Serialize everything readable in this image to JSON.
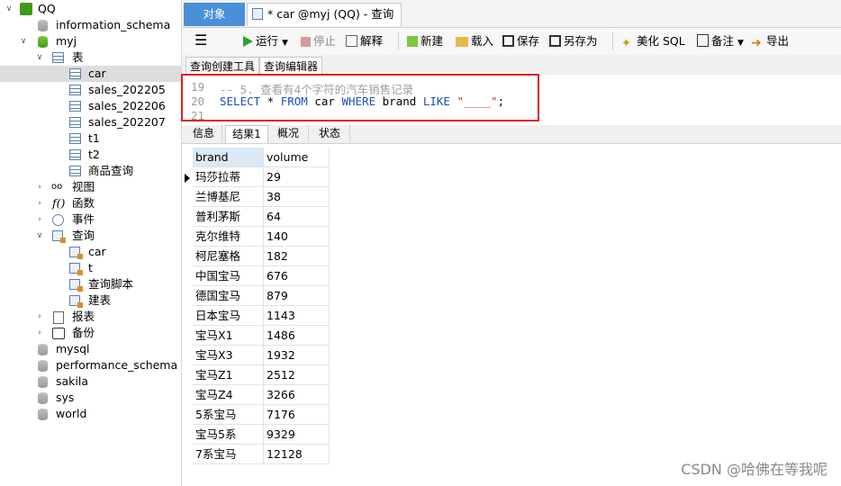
{
  "sidebar": {
    "connection": "QQ",
    "databases_top": [
      "information_schema"
    ],
    "active_db": "myj",
    "tables_label": "表",
    "tables": [
      "car",
      "sales_202205",
      "sales_202206",
      "sales_202207",
      "t1",
      "t2",
      "商品查询"
    ],
    "selected_table": "car",
    "views_label": "视图",
    "functions_label": "函数",
    "events_label": "事件",
    "queries_label": "查询",
    "queries": [
      "car",
      "t",
      "查询脚本",
      "建表"
    ],
    "reports_label": "报表",
    "backup_label": "备份",
    "databases_bottom": [
      "mysql",
      "performance_schema",
      "sakila",
      "sys",
      "world"
    ]
  },
  "tabs": {
    "objects": "对象",
    "query_tab": "* car @myj (QQ) - 查询"
  },
  "toolbar": {
    "run": "运行",
    "stop": "停止",
    "explain": "解释",
    "new": "新建",
    "load": "载入",
    "save": "保存",
    "save_as": "另存为",
    "beautify": "美化 SQL",
    "note": "备注",
    "export": "导出"
  },
  "subtabs": {
    "builder": "查询创建工具",
    "editor": "查询编辑器"
  },
  "editor": {
    "lines": [
      {
        "num": "19",
        "comment": "-- 5. 查看有4个字符的汽车销售记录"
      },
      {
        "num": "20",
        "sql_kw1": "SELECT",
        "sql_a": " * ",
        "sql_kw2": "FROM",
        "sql_b": " car ",
        "sql_kw3": "WHERE",
        "sql_c": " brand ",
        "sql_kw4": "LIKE",
        "sql_str": " \"____\"",
        "sql_end": ";"
      },
      {
        "num": "21"
      }
    ]
  },
  "result_tabs": [
    "信息",
    "结果1",
    "概况",
    "状态"
  ],
  "grid": {
    "columns": [
      "brand",
      "volume"
    ],
    "rows": [
      [
        "玛莎拉蒂",
        "29"
      ],
      [
        "兰博基尼",
        "38"
      ],
      [
        "普利茅斯",
        "64"
      ],
      [
        "克尔维特",
        "140"
      ],
      [
        "柯尼塞格",
        "182"
      ],
      [
        "中国宝马",
        "676"
      ],
      [
        "德国宝马",
        "879"
      ],
      [
        "日本宝马",
        "1143"
      ],
      [
        "宝马X1",
        "1486"
      ],
      [
        "宝马X3",
        "1932"
      ],
      [
        "宝马Z1",
        "2512"
      ],
      [
        "宝马Z4",
        "3266"
      ],
      [
        "5系宝马",
        "7176"
      ],
      [
        "宝马5系",
        "9329"
      ],
      [
        "7系宝马",
        "12128"
      ]
    ]
  },
  "watermark": "CSDN @哈佛在等我呢",
  "colors": {
    "accent": "#4a90d9",
    "highlight_box": "#e02020",
    "keyword": "#1f4fbf"
  }
}
